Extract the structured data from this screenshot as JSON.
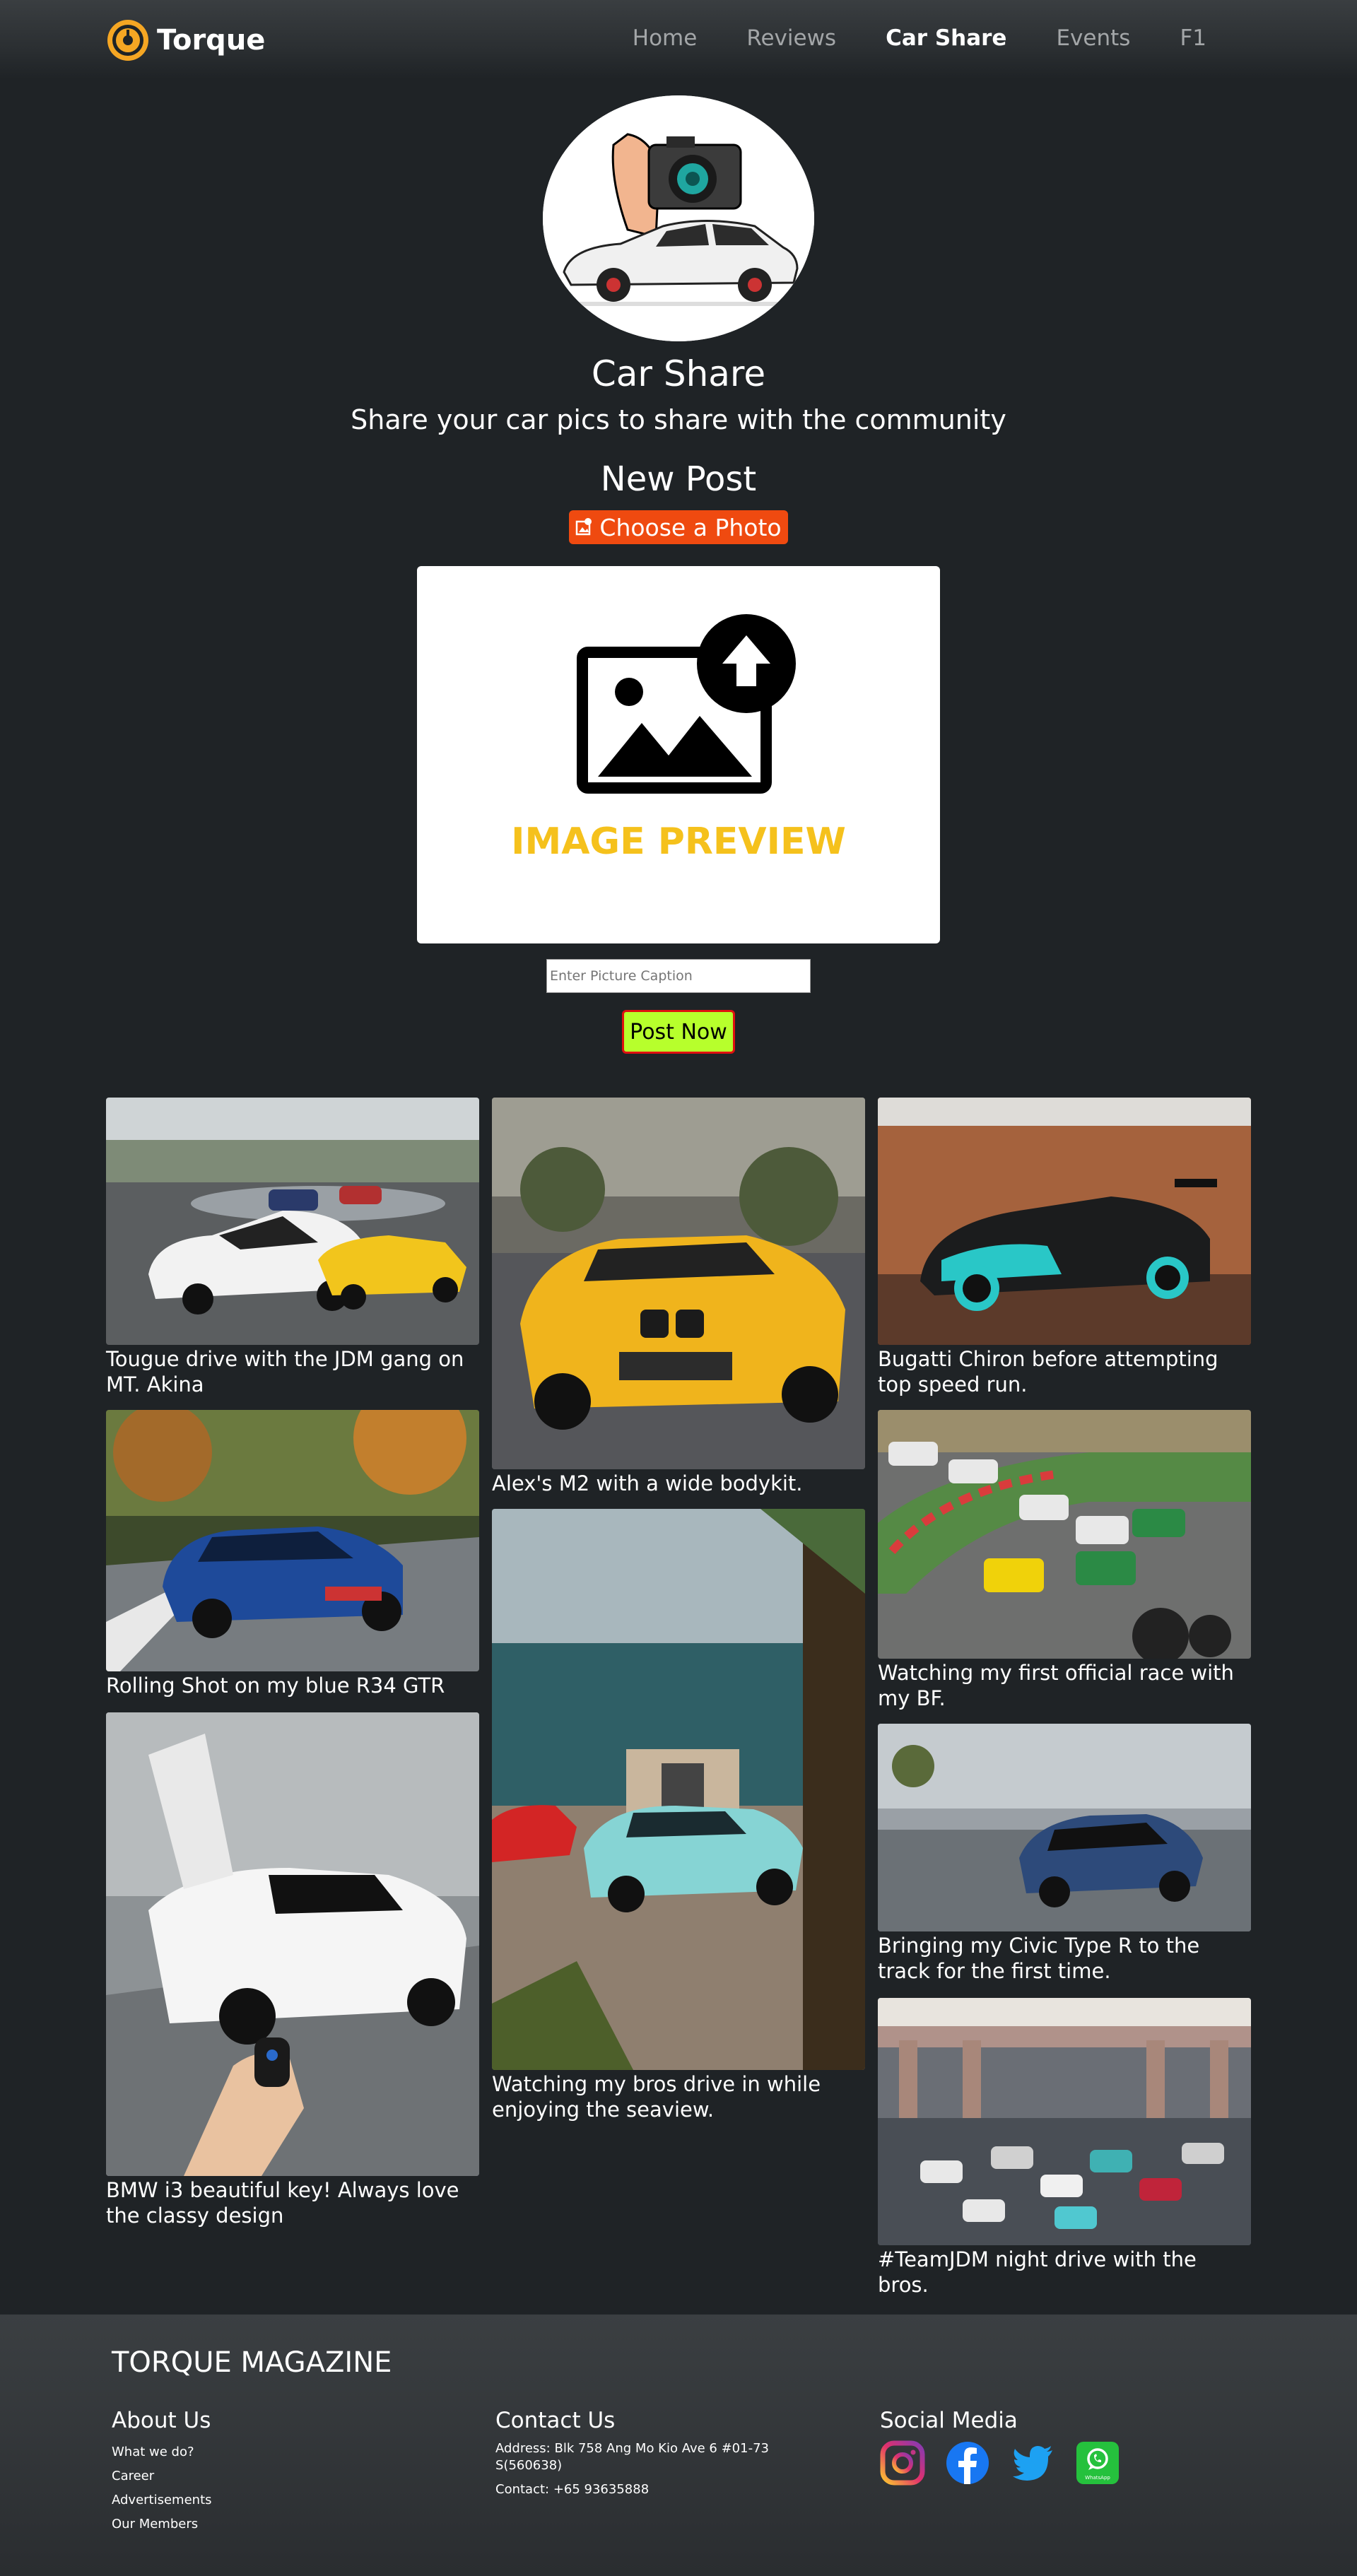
{
  "nav": {
    "brand": "Torque",
    "links": [
      "Home",
      "Reviews",
      "Car Share",
      "Events",
      "F1"
    ],
    "active": "Car Share"
  },
  "hero": {
    "title": "Car Share",
    "subtitle": "Share your car pics to share with the community"
  },
  "new_post": {
    "title": "New Post",
    "choose_label": "Choose a Photo",
    "preview_label": "IMAGE PREVIEW",
    "caption_placeholder": "Enter Picture Caption",
    "post_label": "Post Now"
  },
  "posts": [
    {
      "caption": "Tougue drive with the JDM gang on MT. Akina"
    },
    {
      "caption": "Rolling Shot on my blue R34 GTR"
    },
    {
      "caption": "BMW i3 beautiful key! Always love the classy design"
    },
    {
      "caption": "Alex's M2 with a wide bodykit."
    },
    {
      "caption": "Watching my bros drive in while enjoying the seaview."
    },
    {
      "caption": "Bugatti Chiron before attempting top speed run."
    },
    {
      "caption": "Watching my first official race with my BF."
    },
    {
      "caption": "Bringing my Civic Type R to the track for the first time."
    },
    {
      "caption": "#TeamJDM night drive with the bros."
    }
  ],
  "footer": {
    "title": "TORQUE MAGAZINE",
    "about": {
      "heading": "About Us",
      "links": [
        "What we do?",
        "Career",
        "Advertisements",
        "Our Members"
      ]
    },
    "contact": {
      "heading": "Contact Us",
      "address": "Address: Blk 758 Ang Mo Kio Ave 6 #01-73 S(560638)",
      "phone": "Contact: +65 93635888"
    },
    "social": {
      "heading": "Social Media",
      "icons": [
        "instagram-icon",
        "facebook-icon",
        "twitter-icon",
        "whatsapp-icon"
      ],
      "whatsapp_label": "WhatsApp"
    }
  },
  "colors": {
    "background": "#1f2326",
    "accent_orange": "#ef4a10",
    "post_button": "#b7ff2c",
    "preview_text": "#f5c11c"
  }
}
